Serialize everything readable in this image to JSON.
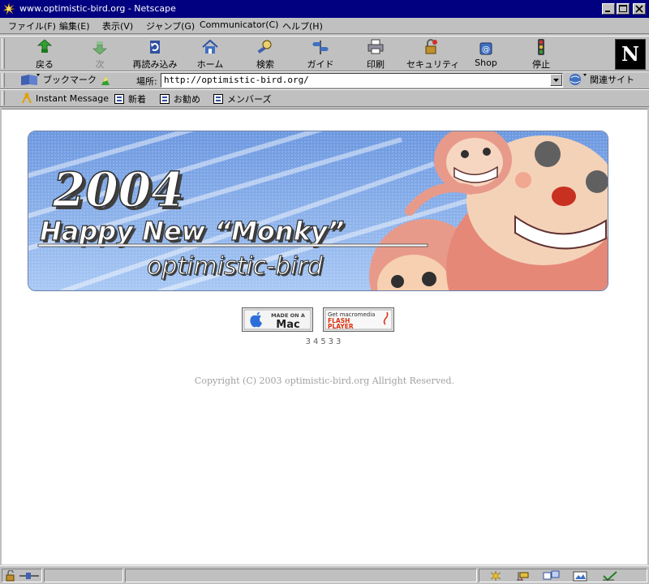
{
  "window": {
    "title": "www.optimistic-bird.org - Netscape"
  },
  "menubar": {
    "items": [
      "ファイル(F)",
      "編集(E)",
      "表示(V)",
      "ジャンプ(G)",
      "Communicator(C)",
      "ヘルプ(H)"
    ]
  },
  "toolbar": {
    "back": "戻る",
    "forward": "次",
    "reload": "再読み込み",
    "home": "ホーム",
    "search": "検索",
    "guide": "ガイド",
    "print": "印刷",
    "security": "セキュリティ",
    "shop": "Shop",
    "stop": "停止",
    "logo": "N"
  },
  "location": {
    "bookmarks_label": "ブックマーク",
    "label": "場所:",
    "url": "http://optimistic-bird.org/",
    "related": "関連サイト"
  },
  "personal_bar": {
    "items": [
      "Instant Message",
      "新着",
      "お勧め",
      "メンバーズ"
    ]
  },
  "page": {
    "banner": {
      "year": "2004",
      "headline": "Happy New “Monky”",
      "site": "optimistic-bird"
    },
    "mac_badge": {
      "line1": "MADE ON A",
      "line2": "Mac"
    },
    "flash_badge": {
      "line1": "Get macromedia",
      "line2": "FLASH",
      "line3": "PLAYER"
    },
    "counter": "34533",
    "copyright": "Copyright (C) 2003 optimistic-bird.org Allright Reserved."
  },
  "colors": {
    "titlebar": "#000080",
    "chrome": "#c0c0c0",
    "banner_sky": "#7ea8e8",
    "monkey": "#e89a8a"
  }
}
